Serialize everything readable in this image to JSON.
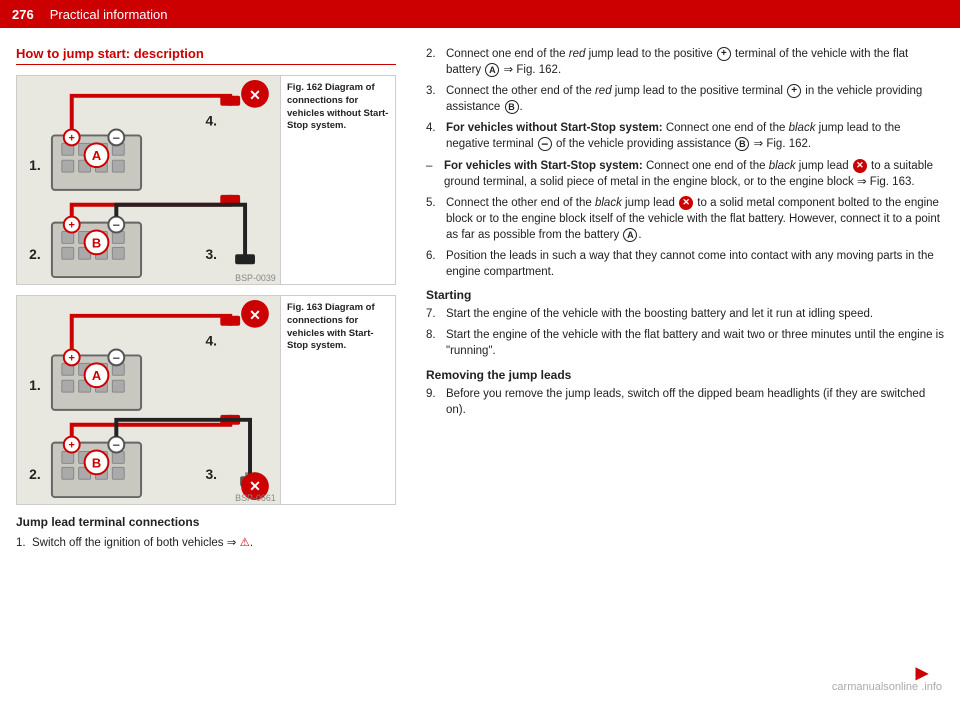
{
  "header": {
    "page_number": "276",
    "title": "Practical information"
  },
  "left": {
    "section_title": "How to jump start: description",
    "fig162_caption": "Fig. 162   Diagram of connections for vehicles without Start-Stop system.",
    "fig163_caption": "Fig. 163   Diagram of connections for vehicles with Start-Stop system.",
    "subsection_title": "Jump lead terminal connections",
    "step1": "Switch off the ignition of both vehicles ⇒"
  },
  "right": {
    "steps": [
      {
        "num": "2.",
        "text": "Connect one end of the red jump lead to the positive + terminal of the vehicle with the flat battery A ⇒ Fig. 162."
      },
      {
        "num": "3.",
        "text": "Connect the other end of the red jump lead to the positive terminal + in the vehicle providing assistance B."
      },
      {
        "num": "4.",
        "text_bold": "For vehicles without Start-Stop system:",
        "text": " Connect one end of the black jump lead to the negative terminal – of the vehicle providing assistance B ⇒ Fig. 162."
      },
      {
        "num": "–",
        "text_bold": "For vehicles with Start-Stop system:",
        "text": " Connect one end of the black jump lead X to a suitable ground terminal, a solid piece of metal in the engine block, or to the engine block ⇒ Fig. 163.",
        "is_dash": true
      },
      {
        "num": "5.",
        "text": "Connect the other end of the black jump lead X to a solid metal component bolted to the engine block or to the engine block itself of the vehicle with the flat battery. However, connect it to a point as far as possible from the battery A."
      },
      {
        "num": "6.",
        "text": "Position the leads in such a way that they cannot come into contact with any moving parts in the engine compartment."
      }
    ],
    "section_starting": "Starting",
    "steps_starting": [
      {
        "num": "7.",
        "text": "Start the engine of the vehicle with the boosting battery and let it run at idling speed."
      },
      {
        "num": "8.",
        "text": "Start the engine of the vehicle with the flat battery and wait two or three minutes until the engine is \"running\"."
      }
    ],
    "section_removing": "Removing the jump leads",
    "steps_removing": [
      {
        "num": "9.",
        "text": "Before you remove the jump leads, switch off the dipped beam headlights (if they are switched on)."
      }
    ]
  },
  "watermark": "carmanualsonline .info"
}
